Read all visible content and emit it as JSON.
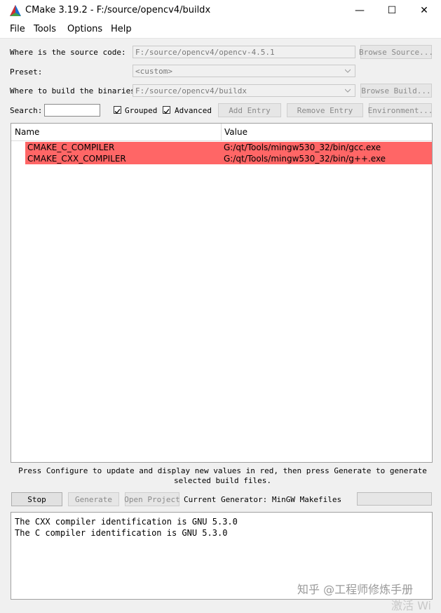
{
  "window": {
    "title": "CMake 3.19.2 - F:/source/opencv4/buildx",
    "minimize_glyph": "—",
    "maximize_glyph": "☐",
    "close_glyph": "✕",
    "icon": "cmake-logo-icon"
  },
  "menu": [
    "File",
    "Tools",
    "Options",
    "Help"
  ],
  "source": {
    "label": "Where is the source code:",
    "value": "F:/source/opencv4/opencv-4.5.1",
    "browse_label": "Browse Source..."
  },
  "preset": {
    "label": "Preset:",
    "value": "<custom>"
  },
  "build": {
    "label": "Where to build the binaries:",
    "value": "F:/source/opencv4/buildx",
    "browse_label": "Browse Build..."
  },
  "search": {
    "label": "Search:",
    "value": "",
    "grouped_label": "Grouped",
    "grouped_checked": true,
    "advanced_label": "Advanced",
    "advanced_checked": true,
    "add_entry_label": "Add Entry",
    "remove_entry_label": "Remove Entry",
    "environment_label": "Environment..."
  },
  "table": {
    "columns": [
      "Name",
      "Value"
    ],
    "rows": [
      {
        "name": "CMAKE_C_COMPILER",
        "value": "G:/qt/Tools/mingw530_32/bin/gcc.exe",
        "highlight": "#ff6666"
      },
      {
        "name": "CMAKE_CXX_COMPILER",
        "value": "G:/qt/Tools/mingw530_32/bin/g++.exe",
        "highlight": "#ff6666"
      }
    ]
  },
  "hint": "Press Configure to update and display new values in red, then press Generate to generate selected build files.",
  "actions": {
    "stop_label": "Stop",
    "generate_label": "Generate",
    "open_project_label": "Open Project",
    "generator_text": "Current Generator: MinGW Makefiles",
    "progress": 0
  },
  "output": [
    "The CXX compiler identification is GNU 5.3.0",
    "The C compiler identification is GNU 5.3.0"
  ],
  "watermark": "知乎 @工程师修炼手册",
  "activation_mark": "激活 Wi"
}
